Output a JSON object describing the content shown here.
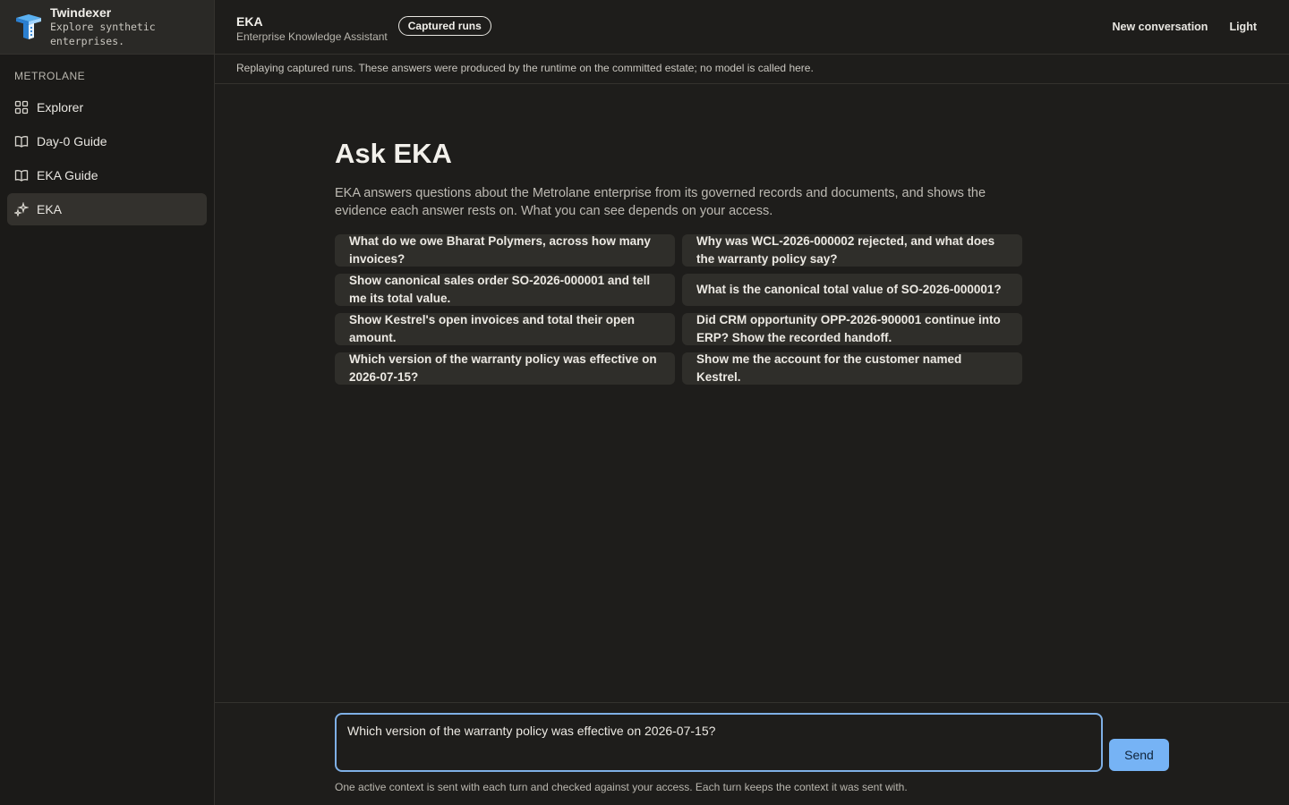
{
  "sidebar": {
    "brand_name": "Twindexer",
    "brand_tagline": "Explore synthetic enterprises.",
    "section_label": "METROLANE",
    "items": [
      {
        "label": "Explorer",
        "icon": "grid-icon"
      },
      {
        "label": "Day-0 Guide",
        "icon": "book-icon"
      },
      {
        "label": "EKA Guide",
        "icon": "book-icon"
      },
      {
        "label": "EKA",
        "icon": "sparkles-icon",
        "active": true
      }
    ]
  },
  "header": {
    "title": "EKA",
    "subtitle": "Enterprise Knowledge Assistant",
    "badge": "Captured runs",
    "new_conversation": "New conversation",
    "theme_toggle": "Light"
  },
  "notice": "Replaying captured runs. These answers were produced by the runtime on the committed estate; no model is called here.",
  "main": {
    "heading": "Ask EKA",
    "intro": "EKA answers questions about the Metrolane enterprise from its governed records and documents, and shows the evidence each answer rests on. What you can see depends on your access.",
    "suggestions": [
      "What do we owe Bharat Polymers, across how many invoices?",
      "Why was WCL-2026-000002 rejected, and what does the warranty policy say?",
      "Show canonical sales order SO-2026-000001 and tell me its total value.",
      "What is the canonical total value of SO-2026-000001?",
      "Show Kestrel's open invoices and total their open amount.",
      "Did CRM opportunity OPP-2026-900001 continue into ERP? Show the recorded handoff.",
      "Which version of the warranty policy was effective on 2026-07-15?",
      "Show me the account for the customer named Kestrel."
    ]
  },
  "composer": {
    "value": "Which version of the warranty policy was effective on 2026-07-15?",
    "send_label": "Send",
    "footnote": "One active context is sent with each turn and checked against your access. Each turn keeps the context it was sent with."
  },
  "colors": {
    "accent": "#76b3f5",
    "focus_ring": "#7fb0e6",
    "background": "#1e1d1b",
    "chip": "#2f2e2a"
  }
}
